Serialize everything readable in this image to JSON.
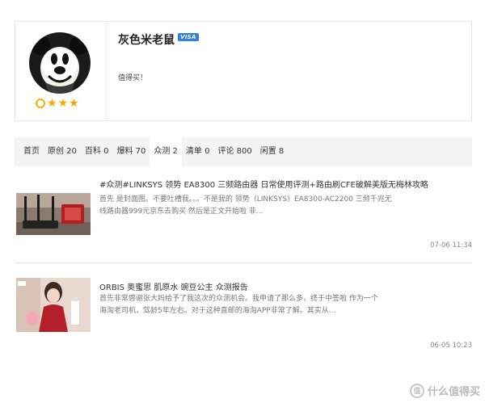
{
  "profile": {
    "username": "灰色米老鼠",
    "badge": "VISA",
    "bio": "值得买！",
    "avatar_icon": "mickey-mouse-avatar",
    "level_stars": 3
  },
  "tabs": [
    {
      "label": "首页"
    },
    {
      "label": "原创 20"
    },
    {
      "label": "百科 0"
    },
    {
      "label": "爆料 70"
    },
    {
      "label": "众测 2",
      "active": true
    },
    {
      "label": "清单 0"
    },
    {
      "label": "评论 800"
    },
    {
      "label": "闲置 8"
    }
  ],
  "articles": [
    {
      "title": "#众测#LINKSYS 领势 EA8300 三频路由器 日常使用评测+路由刷CFE破解美版无梅林攻略",
      "excerpt": "首先 是封面图。不要吐槽我。。。不是我的 领势（LINKSYS）EA8300-AC2200 三频千兆无线路由器999元京东去购买 然后是正文开始啦 非...",
      "date": "07-06 11:34",
      "thumb_icon": "router-thumbnail"
    },
    {
      "title": "ORBIS 奥蜜思 肌原水 豌豆公主 众测报告",
      "excerpt": "首先非常感谢张大妈给予了我这次的众测机会。我申请了那么多，终于中签啦 作为一个海淘老司机，驾龄5年左右。对于这种直邮的海淘APP非常了解。其实从...",
      "date": "06-05 10:23",
      "thumb_icon": "cosmetics-thumbnail"
    }
  ],
  "watermark": {
    "text": "什么值得买",
    "logo": "值"
  },
  "colors": {
    "accent_star": "#f5a800",
    "badge_blue": "#2f7fe0",
    "tab_bg": "#f4f4f4"
  }
}
